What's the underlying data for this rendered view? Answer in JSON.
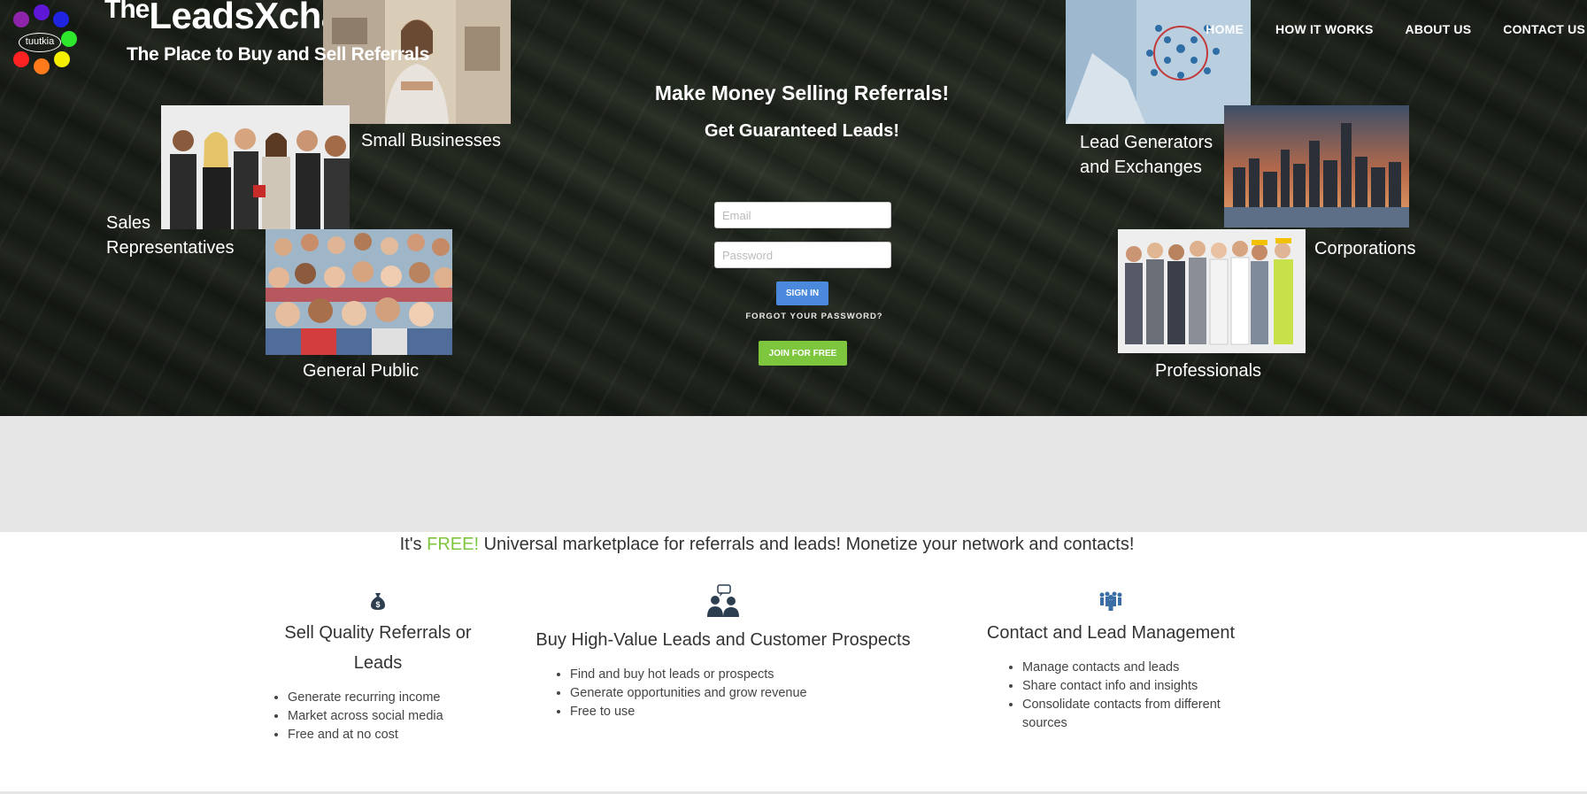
{
  "brand": {
    "the": "The",
    "name": "LeadsXchange",
    "tagline": "The Place to Buy and Sell Referrals",
    "logo_text": "tuutkia"
  },
  "nav": [
    "HOME",
    "HOW IT WORKS",
    "ABOUT US",
    "CONTACT US"
  ],
  "hero": {
    "headline": "Make Money Selling Referrals!",
    "subheadline": "Get Guaranteed Leads!",
    "email_placeholder": "Email",
    "password_placeholder": "Password",
    "signin_label": "SIGN IN",
    "forgot_label": "FORGOT YOUR PASSWORD?",
    "join_label": "JOIN FOR FREE",
    "labels": {
      "small_businesses": "Small Businesses",
      "sales_reps": "Sales Representatives",
      "general_public": "General Public",
      "lead_generators": "Lead Generators and Exchanges",
      "corporations": "Corporations",
      "professionals": "Professionals"
    }
  },
  "slogan": {
    "pre": "It's ",
    "free": "FREE!",
    "post": " Universal marketplace for referrals and leads! Monetize your network and contacts!"
  },
  "features": [
    {
      "icon": "money-bag-icon",
      "title": "Sell Quality Referrals or Leads",
      "items": [
        "Generate recurring income",
        "Market across social media",
        "Free and at no cost"
      ]
    },
    {
      "icon": "people-chat-icon",
      "title": "Buy High-Value Leads and Customer Prospects",
      "items": [
        "Find and buy hot leads or prospects",
        "Generate opportunities and grow revenue",
        "Free to use"
      ]
    },
    {
      "icon": "team-icon",
      "title": "Contact and Lead Management",
      "items": [
        "Manage contacts and leads",
        "Share contact info and insights",
        "Consolidate contacts from different sources"
      ]
    }
  ],
  "colors": {
    "accent_green": "#7dc63e",
    "signin_blue": "#4a89dc",
    "grey_band": "#e6e6e6"
  }
}
